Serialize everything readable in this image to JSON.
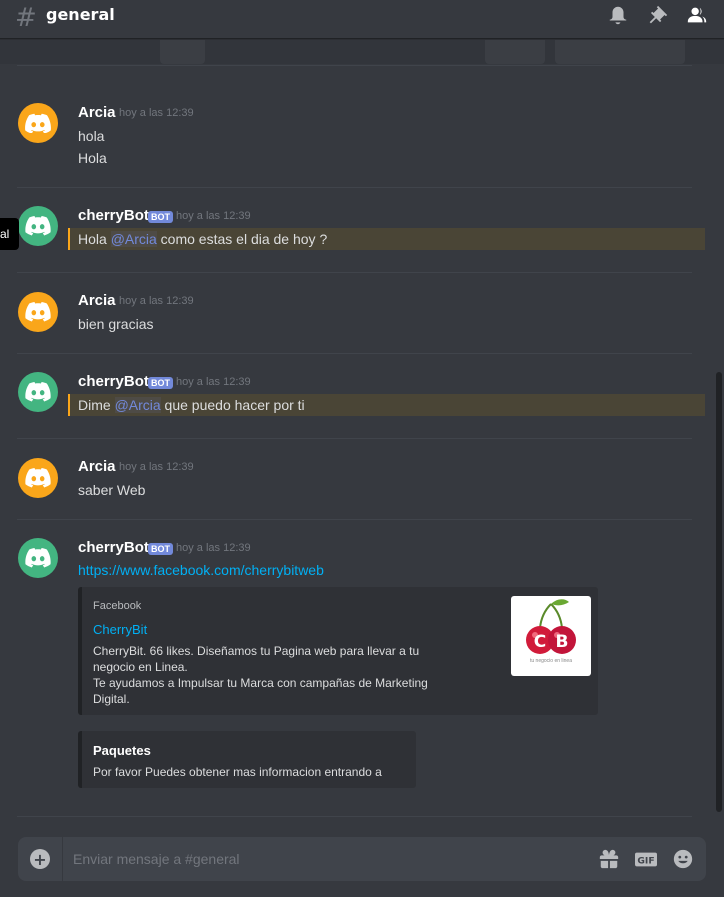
{
  "header": {
    "hash_symbol": "#",
    "channel": "general",
    "icons": [
      "bell-icon",
      "pin-icon",
      "members-icon"
    ]
  },
  "tooltip": {
    "text": "al"
  },
  "messages": [
    {
      "author": "Arcia",
      "timestamp": "hoy a las 12:39",
      "lines": [
        "hola",
        "Hola"
      ],
      "avatar_color": "#faa61a"
    },
    {
      "author": "cherryBot",
      "bot_tag": "BOT",
      "timestamp": "hoy a las 12:39",
      "mention_text": {
        "before": "Hola ",
        "mention": "@Arcia",
        "after": " como estas el dia de hoy ?"
      },
      "avatar_color": "#43b581"
    },
    {
      "author": "Arcia",
      "timestamp": "hoy a las 12:39",
      "lines": [
        "bien gracias"
      ],
      "avatar_color": "#faa61a"
    },
    {
      "author": "cherryBot",
      "bot_tag": "BOT",
      "timestamp": "hoy a las 12:39",
      "mention_text": {
        "before": "Dime ",
        "mention": "@Arcia",
        "after": " que puedo hacer por ti"
      },
      "avatar_color": "#43b581"
    },
    {
      "author": "Arcia",
      "timestamp": "hoy a las 12:39",
      "lines": [
        "saber Web"
      ],
      "avatar_color": "#faa61a"
    },
    {
      "author": "cherryBot",
      "bot_tag": "BOT",
      "timestamp": "hoy a las 12:39",
      "link": "https://www.facebook.com/cherrybitweb",
      "embed": {
        "provider": "Facebook",
        "title": "CherryBit",
        "description": "CherryBit. 66 likes. Diseñamos tu Pagina web para llevar a tu\nnegocio en Linea.\nTe ayudamos a Impulsar tu Marca con campañas de Marketing\nDigital.",
        "thumbnail_caption": "tu negocio en linea",
        "thumbnail_letters": "CB"
      },
      "embed2": {
        "title": "Paquetes",
        "description": "Por favor Puedes obtener mas informacion entrando a"
      },
      "avatar_color": "#43b581"
    }
  ],
  "composer": {
    "plus": "+",
    "placeholder": "Enviar mensaje a #general",
    "icons": [
      "gift-icon",
      "gif-icon",
      "emoji-icon"
    ],
    "gif_label": "GIF"
  },
  "colors": {
    "background": "#36393f",
    "mention": "#7289da",
    "link": "#00b0f4",
    "highlight_border": "#faa61a"
  }
}
